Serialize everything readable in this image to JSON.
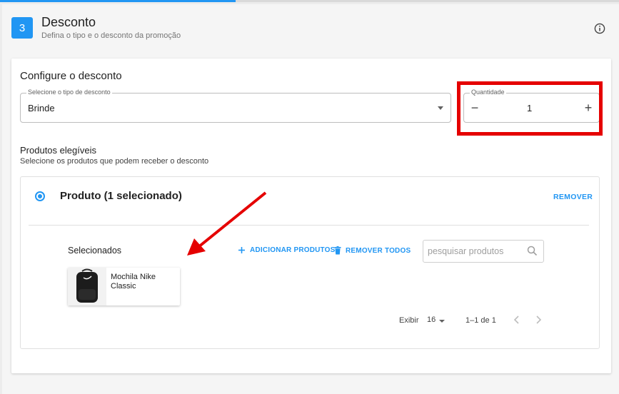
{
  "step": {
    "number": "3",
    "title": "Desconto",
    "subtitle": "Defina o tipo e o desconto da promoção"
  },
  "config": {
    "title": "Configure o desconto",
    "discount_type": {
      "label": "Selecione o tipo de desconto",
      "value": "Brinde"
    },
    "quantity": {
      "label": "Quantidade",
      "value": "1",
      "decrement": "−",
      "increment": "+"
    }
  },
  "eligible": {
    "title": "Produtos elegíveis",
    "subtitle": "Selecione os produtos que podem receber o desconto"
  },
  "product_option": {
    "title": "Produto (1 selecionado)",
    "remove_label": "REMOVER"
  },
  "selected": {
    "label": "Selecionados",
    "add_label": "ADICIONAR PRODUTOS",
    "remove_all_label": "REMOVER TODOS",
    "search_placeholder": "pesquisar produtos",
    "items": [
      {
        "name": "Mochila Nike Classic"
      }
    ]
  },
  "pagination": {
    "show_label": "Exibir",
    "page_size": "16",
    "range": "1–1 de 1"
  },
  "colors": {
    "accent": "#2196f3",
    "annotation": "#e50000"
  }
}
